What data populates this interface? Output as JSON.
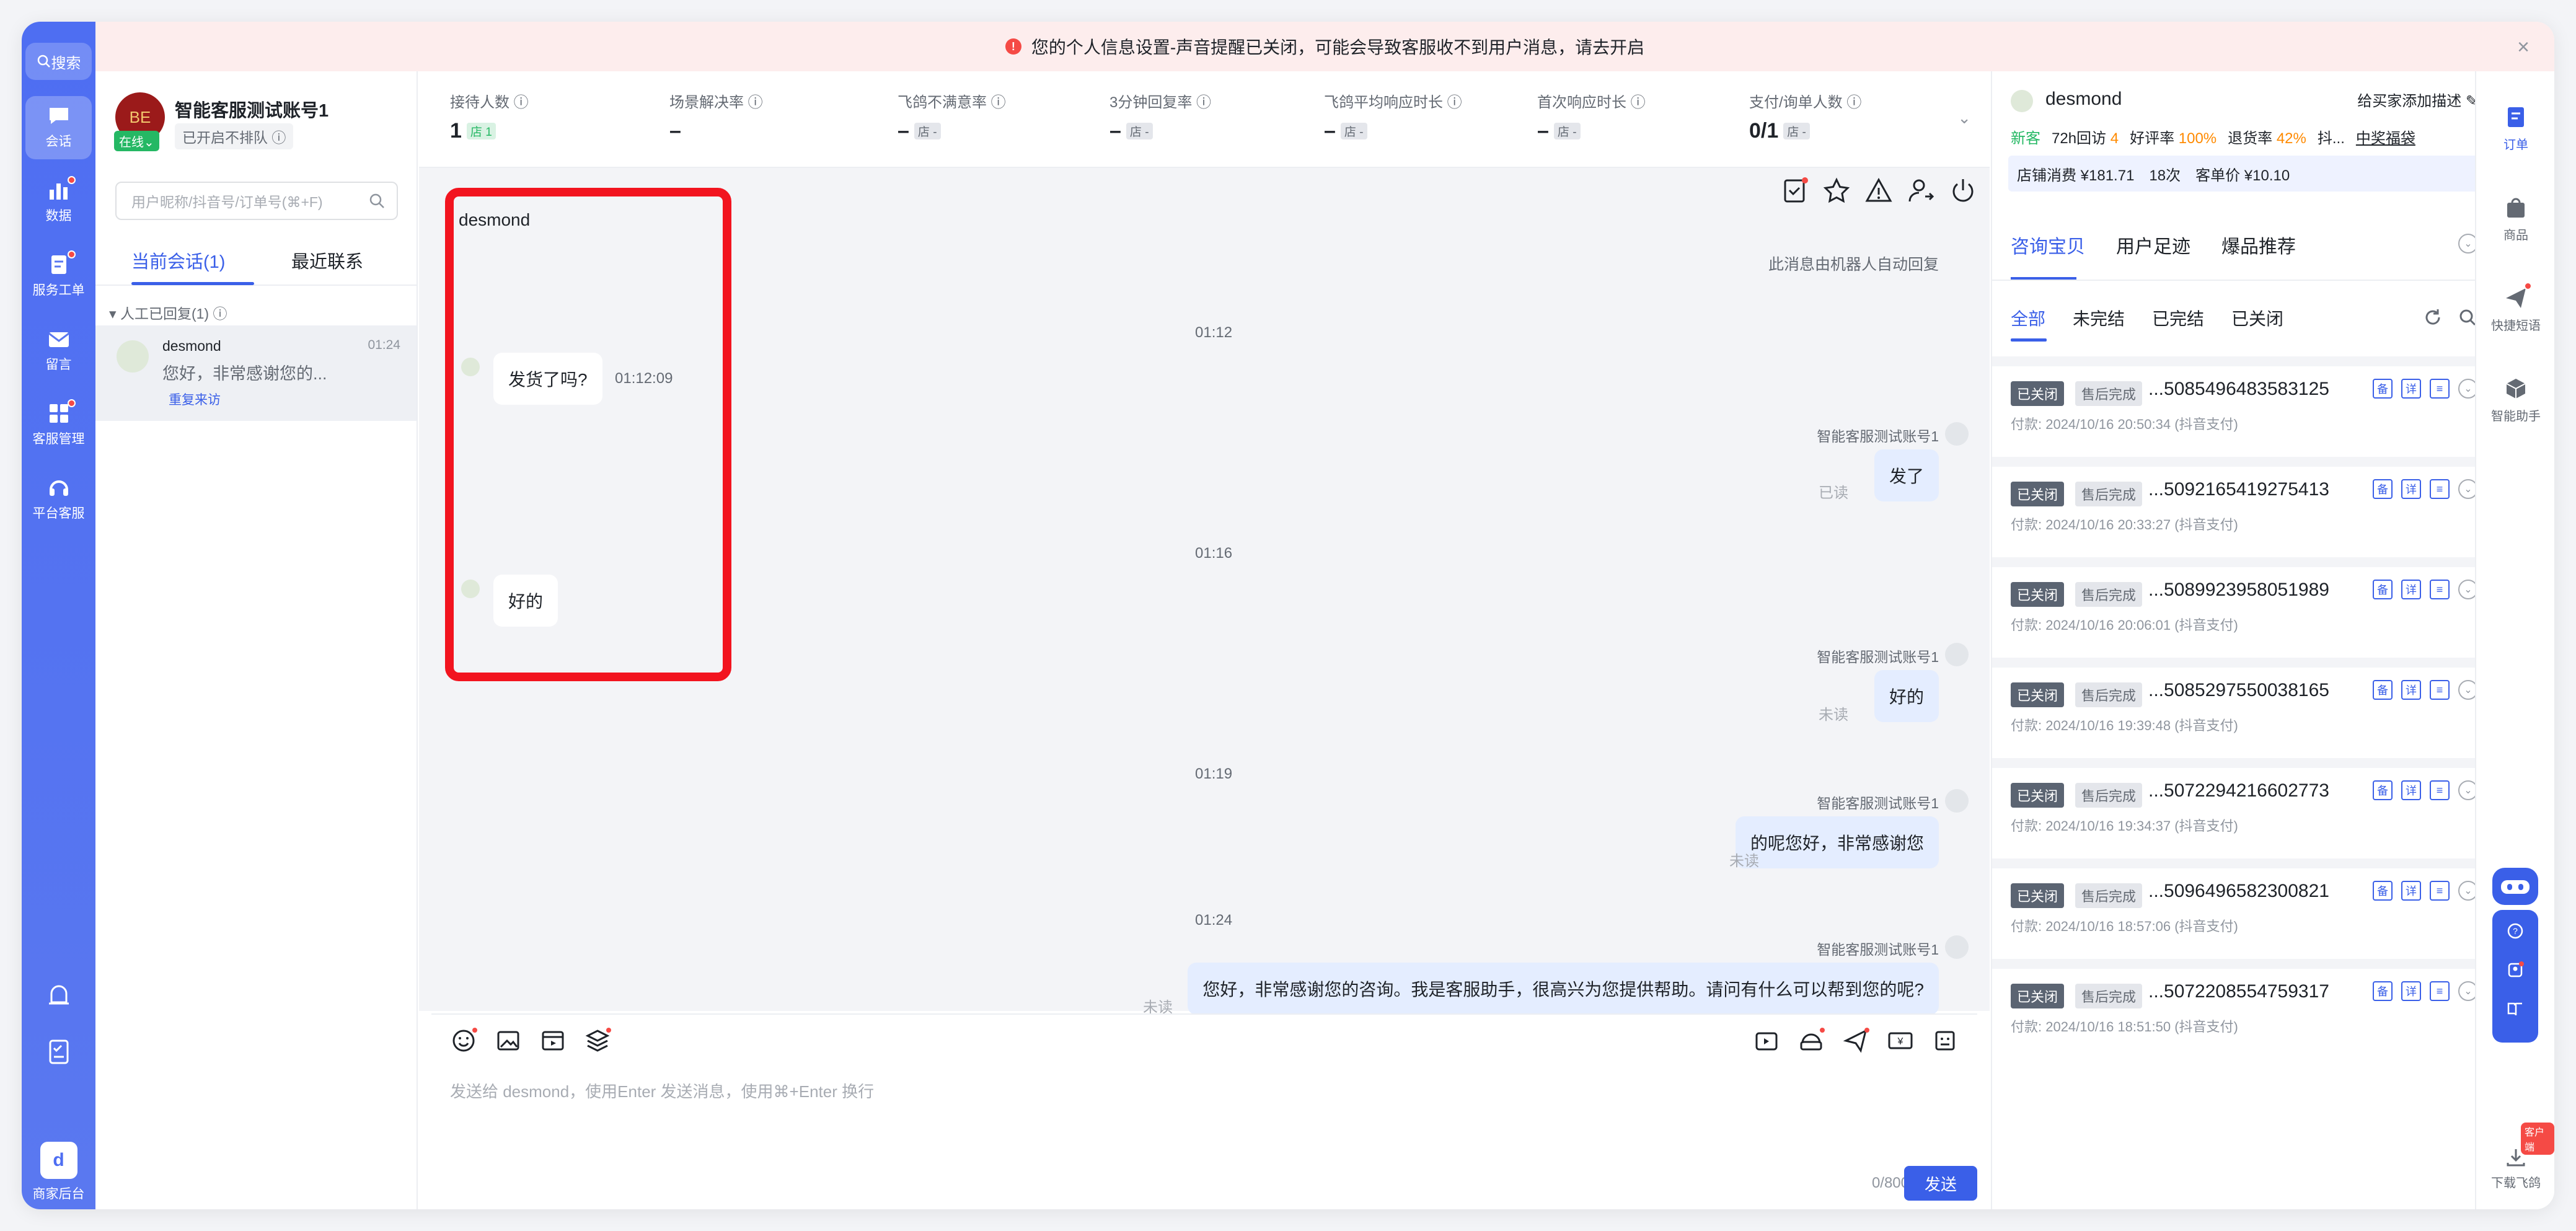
{
  "banner": {
    "text": "您的个人信息设置-声音提醒已关闭，可能会导致客服收不到用户消息，请去开启",
    "close": "×",
    "warn_icon": "!"
  },
  "nav": {
    "search": "搜索",
    "items": [
      {
        "label": "会话",
        "icon": "chat-icon"
      },
      {
        "label": "数据",
        "icon": "bar-chart-icon"
      },
      {
        "label": "服务工单",
        "icon": "ticket-icon"
      },
      {
        "label": "留言",
        "icon": "mail-icon"
      },
      {
        "label": "客服管理",
        "icon": "grid-icon"
      },
      {
        "label": "平台客服",
        "icon": "headset-icon"
      }
    ],
    "merchant": "商家后台"
  },
  "account": {
    "name": "智能客服测试账号1",
    "status": "已开启不排队",
    "online": "在线",
    "avatar_text": "BE"
  },
  "search": {
    "placeholder": "用户昵称/抖音号/订单号(⌘+F)"
  },
  "left_tabs": {
    "current": "当前会话(1)",
    "recent": "最近联系"
  },
  "group": {
    "label": "人工已回复(1)"
  },
  "conversation": {
    "name": "desmond",
    "time": "01:24",
    "preview": "您好，非常感谢您的...",
    "tag": "重复来访"
  },
  "stats": [
    {
      "label": "接待人数",
      "value": "1",
      "badge": "店 1"
    },
    {
      "label": "场景解决率",
      "value": "–",
      "badge": ""
    },
    {
      "label": "飞鸽不满意率",
      "value": "–",
      "badge": "店 -"
    },
    {
      "label": "3分钟回复率",
      "value": "–",
      "badge": "店 -"
    },
    {
      "label": "飞鸽平均响应时长",
      "value": "–",
      "badge": "店 -"
    },
    {
      "label": "首次响应时长",
      "value": "–",
      "badge": "店 -"
    },
    {
      "label": "支付/询单人数",
      "value": "0/1",
      "badge": "店 -"
    }
  ],
  "chat": {
    "peer_name": "desmond",
    "auto_note": "此消息由机器人自动回复",
    "bot_name": "智能客服测试账号1",
    "t1": "01:12",
    "t2": "01:16",
    "t3": "01:19",
    "t4": "01:24",
    "msg1": "发货了吗?",
    "msg1_time": "01:12:09",
    "reply1": "发了",
    "reply1_state": "已读",
    "msg2": "好的",
    "reply2": "好的",
    "reply2_state": "未读",
    "reply3": "的呢您好，非常感谢您",
    "reply3_state": "未读",
    "reply4": "您好，非常感谢您的咨询。我是客服助手，很高兴为您提供帮助。请问有什么可以帮到您的呢?",
    "reply4_state": "未读"
  },
  "input": {
    "placeholder": "发送给 desmond，使用Enter 发送消息，使用⌘+Enter 换行",
    "counter": "0/800",
    "send": "发送"
  },
  "customer": {
    "name": "desmond",
    "add_desc": "给买家添加描述",
    "new": "新客",
    "revisit": "72h回访",
    "revisit_val": "4",
    "good_rate": "好评率",
    "good_val": "100%",
    "refund": "退货率",
    "refund_val": "42%",
    "extra": "抖...",
    "award": "中奖福袋",
    "spend": "店铺消费 ¥181.71",
    "orders": "18次",
    "avg": "客单价 ¥10.10"
  },
  "right_tabs": [
    "咨询宝贝",
    "用户足迹",
    "爆品推荐"
  ],
  "filter_tabs": [
    "全部",
    "未完结",
    "已完结",
    "已关闭"
  ],
  "orders": [
    {
      "status": "已关闭",
      "sub": "售后完成",
      "id": "...5085496483583125",
      "pay": "付款: 2024/10/16 20:50:34 (抖音支付)"
    },
    {
      "status": "已关闭",
      "sub": "售后完成",
      "id": "...5092165419275413",
      "pay": "付款: 2024/10/16 20:33:27 (抖音支付)"
    },
    {
      "status": "已关闭",
      "sub": "售后完成",
      "id": "...5089923958051989",
      "pay": "付款: 2024/10/16 20:06:01 (抖音支付)"
    },
    {
      "status": "已关闭",
      "sub": "售后完成",
      "id": "...5085297550038165",
      "pay": "付款: 2024/10/16 19:39:48 (抖音支付)"
    },
    {
      "status": "已关闭",
      "sub": "售后完成",
      "id": "...5072294216602773",
      "pay": "付款: 2024/10/16 19:34:37 (抖音支付)"
    },
    {
      "status": "已关闭",
      "sub": "售后完成",
      "id": "...5096496582300821",
      "pay": "付款: 2024/10/16 18:57:06 (抖音支付)"
    },
    {
      "status": "已关闭",
      "sub": "售后完成",
      "id": "...5072208554759317",
      "pay": "付款: 2024/10/16 18:51:50 (抖音支付)"
    }
  ],
  "order_actions": {
    "a": "备",
    "b": "详",
    "chev": "⌄"
  },
  "right_nav": [
    {
      "label": "订单",
      "icon": "order-icon"
    },
    {
      "label": "商品",
      "icon": "bag-icon"
    },
    {
      "label": "快捷短语",
      "icon": "send-icon"
    },
    {
      "label": "智能助手",
      "icon": "cube-icon"
    }
  ],
  "download": {
    "label": "下载飞鸽",
    "tag": "客户端"
  }
}
